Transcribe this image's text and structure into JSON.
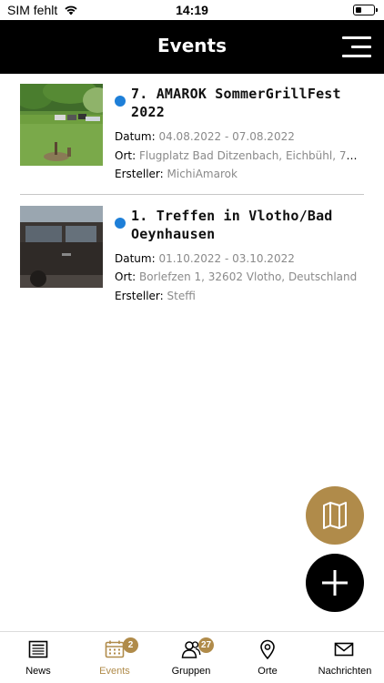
{
  "status_bar": {
    "carrier": "SIM fehlt",
    "time": "14:19"
  },
  "header": {
    "title": "Events"
  },
  "events": [
    {
      "title": "7. AMAROK SommerGrillFest 2022",
      "date_label": "Datum:",
      "date": "04.08.2022 - 07.08.2022",
      "location_label": "Ort:",
      "location": "Flugplatz Bad Ditzenbach, Eichbühl, 73…",
      "creator_label": "Ersteller:",
      "creator": "MichiAmarok"
    },
    {
      "title": "1. Treffen in Vlotho/Bad Oeynhausen",
      "date_label": "Datum:",
      "date": "01.10.2022 - 03.10.2022",
      "location_label": "Ort:",
      "location": "Borlefzen 1, 32602 Vlotho, Deutschland",
      "creator_label": "Ersteller:",
      "creator": "Steffi"
    }
  ],
  "tabs": [
    {
      "label": "News",
      "icon": "newspaper-icon"
    },
    {
      "label": "Events",
      "icon": "calendar-icon",
      "badge": "2",
      "active": true
    },
    {
      "label": "Gruppen",
      "icon": "group-icon",
      "badge": "27"
    },
    {
      "label": "Orte",
      "icon": "location-pin-icon"
    },
    {
      "label": "Nachrichten",
      "icon": "envelope-icon"
    }
  ],
  "colors": {
    "accent": "#b08b4a",
    "dot": "#1e7fd8",
    "header_bg": "#000000"
  }
}
